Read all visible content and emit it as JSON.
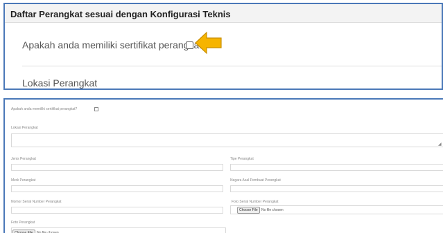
{
  "top": {
    "title": "Daftar Perangkat sesuai dengan Konfigurasi Teknis",
    "question": "Apakah anda memiliki sertifikat perangkat?",
    "location_label": "Lokasi Perangkat",
    "arrow_color": "#F6B400",
    "arrow_icon": "arrow-left-icon"
  },
  "form": {
    "question": "Apakah anda memiliki sertifikat perangkat?",
    "location_label": "Lokasi Perangkat",
    "jenis_label": "Jenis Perangkat",
    "tipe_label": "Tipe Perangkat",
    "merk_label": "Merk Perangkat",
    "negara_label": "Negara Asal Pembuat Perangkat",
    "serial_label": "Nomor Serial Number Perangkat",
    "foto_serial_label": "Foto Serial Number Perangkat",
    "foto_label": "Foto Perangkat",
    "choose_file": "Choose File",
    "no_file": "No file chosen"
  }
}
